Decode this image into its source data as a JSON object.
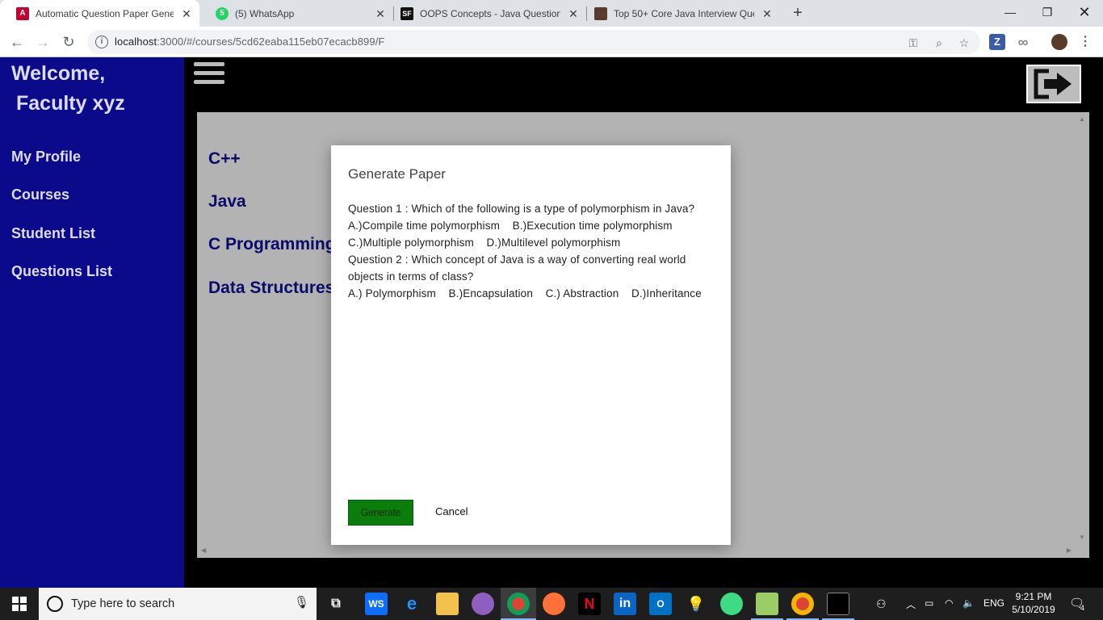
{
  "browser": {
    "tabs": [
      {
        "title": "Automatic Question Paper Gener",
        "favicon": "angular-icon",
        "active": true
      },
      {
        "title": "(5) WhatsApp",
        "favicon": "whatsapp-icon",
        "active": false
      },
      {
        "title": "OOPS Concepts - Java Questions",
        "favicon": "sf-icon",
        "active": false
      },
      {
        "title": "Top 50+ Core Java Interview Que",
        "favicon": "site-icon",
        "active": false
      }
    ],
    "favicon_labels": {
      "sf": "SF",
      "wa": "5"
    },
    "url_host": "localhost",
    "url_rest": ":3000/#/courses/5cd62eaba115eb07ecacb899/F",
    "ext_z": "Z",
    "ext_inf": "∞"
  },
  "sidebar": {
    "welcome": "Welcome,",
    "name": "Faculty xyz",
    "items": [
      {
        "label": "My Profile"
      },
      {
        "label": "Courses"
      },
      {
        "label": "Student List"
      },
      {
        "label": "Questions List"
      }
    ]
  },
  "courses": [
    {
      "label": "C++"
    },
    {
      "label": "Java"
    },
    {
      "label": "C Programming"
    },
    {
      "label": "Data Structures"
    }
  ],
  "modal": {
    "title": "Generate Paper",
    "questions": [
      {
        "text": "Question 1 : Which of the following is a type of polymorphism in Java?",
        "options_line1": "A.)Compile time polymorphism    B.)Execution time polymorphism",
        "options_line2": "C.)Multiple polymorphism    D.)Multilevel polymorphism"
      },
      {
        "text": "Question 2 : Which concept of Java is a way of converting real world objects in terms of class?",
        "options_line1": "A.) Polymorphism    B.)Encapsulation    C.) Abstraction    D.)Inheritance"
      }
    ],
    "generate_label": "Generate",
    "cancel_label": "Cancel"
  },
  "taskbar": {
    "search_placeholder": "Type here to search",
    "lang": "ENG",
    "time": "9:21 PM",
    "date": "5/10/2019",
    "notifications": "4",
    "apps": [
      {
        "name": "webstorm-icon",
        "label": "WS"
      },
      {
        "name": "edge-icon",
        "label": "e"
      },
      {
        "name": "file-explorer-icon",
        "label": ""
      },
      {
        "name": "purple-app-icon",
        "label": ""
      },
      {
        "name": "chrome-icon",
        "label": ""
      },
      {
        "name": "firefox-icon",
        "label": ""
      },
      {
        "name": "netflix-icon",
        "label": "N"
      },
      {
        "name": "linkedin-icon",
        "label": "in"
      },
      {
        "name": "outlook-icon",
        "label": "O"
      },
      {
        "name": "tips-icon",
        "label": ""
      },
      {
        "name": "android-studio-icon",
        "label": ""
      },
      {
        "name": "chart-app-icon",
        "label": ""
      },
      {
        "name": "chrome-icon-2",
        "label": ""
      },
      {
        "name": "terminal-icon",
        "label": ""
      }
    ]
  },
  "colors": {
    "sidebar_bg": "#0a0a8a",
    "content_bg": "#b3b3b3",
    "generate_bg": "#0a7d0a",
    "course_text": "#0a0a6a"
  }
}
